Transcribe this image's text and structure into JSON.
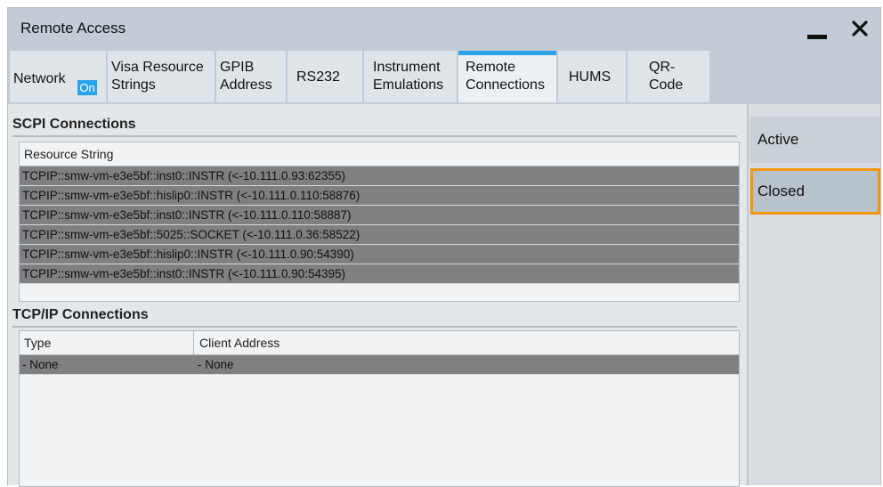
{
  "window": {
    "title": "Remote Access"
  },
  "tabs": [
    {
      "label": "Network",
      "badge": "On"
    },
    {
      "label": "Visa Resource\nStrings"
    },
    {
      "label": "GPIB\nAddress"
    },
    {
      "label": "RS232"
    },
    {
      "label": "Instrument\nEmulations"
    },
    {
      "label": "Remote\nConnections",
      "active": true
    },
    {
      "label": "HUMS"
    },
    {
      "label": "QR-\nCode"
    }
  ],
  "scpi": {
    "title": "SCPI Connections",
    "header": "Resource String",
    "rows": [
      "TCPIP::smw-vm-e3e5bf::inst0::INSTR (<-10.111.0.93:62355)",
      "TCPIP::smw-vm-e3e5bf::hislip0::INSTR (<-10.111.0.110:58876)",
      "TCPIP::smw-vm-e3e5bf::inst0::INSTR (<-10.111.0.110:58887)",
      "TCPIP::smw-vm-e3e5bf::5025::SOCKET (<-10.111.0.36:58522)",
      "TCPIP::smw-vm-e3e5bf::hislip0::INSTR (<-10.111.0.90:54390)",
      "TCPIP::smw-vm-e3e5bf::inst0::INSTR (<-10.111.0.90:54395)"
    ]
  },
  "tcpip": {
    "title": "TCP/IP Connections",
    "headers": [
      "Type",
      "Client Address"
    ],
    "rows": [
      [
        "- None",
        "- None"
      ]
    ]
  },
  "sidebar": {
    "buttons": [
      {
        "label": "Active"
      },
      {
        "label": "Closed",
        "selected": true
      }
    ]
  },
  "colors": {
    "accent": "#2aa4e8",
    "selection_border": "#f0960e",
    "row_highlight": "#808080"
  }
}
